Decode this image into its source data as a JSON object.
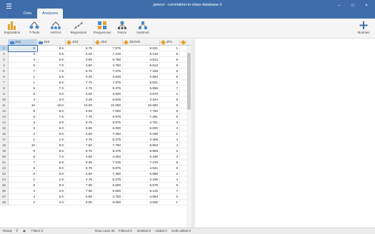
{
  "window": {
    "title": "jamovi - correlation-in-class-database-3"
  },
  "tabs": {
    "data": "Data",
    "analyses": "Analyses"
  },
  "ribbon": [
    {
      "name": "exploration",
      "label": "Exploration"
    },
    {
      "name": "ttests",
      "label": "T-Tests"
    },
    {
      "name": "anova",
      "label": "ANOVA"
    },
    {
      "name": "regression",
      "label": "Regression"
    },
    {
      "name": "frequencies",
      "label": "Frequencies"
    },
    {
      "name": "factor",
      "label": "Factor"
    },
    {
      "name": "medmod",
      "label": "medmod"
    }
  ],
  "modules": {
    "label": "Modules"
  },
  "colors": {
    "titlebar": "#3e6da9",
    "accent": "#e8a22c",
    "nominal": "#4a88cc"
  },
  "columns": [
    {
      "name": "JS1",
      "icon": "ruler-icon"
    },
    {
      "name": "JS2",
      "icon": "ruler-icon"
    },
    {
      "name": "JS3",
      "icon": "pencil-icon"
    },
    {
      "name": "JS4",
      "icon": "pencil-icon"
    },
    {
      "name": "JSAVG",
      "icon": "pencil-icon"
    },
    {
      "name": "JF1",
      "icon": "pencil-icon"
    }
  ],
  "rows": [
    [
      "9",
      "9.5",
      "6.75",
      "7.875",
      "9.031",
      "1"
    ],
    [
      "5",
      "6.5",
      "6.25",
      "7.125",
      "6.219",
      "6"
    ],
    [
      "4",
      "5.0",
      "3.50",
      "6.750",
      "4.813",
      "5"
    ],
    [
      "6",
      "7.0",
      "3.50",
      "4.750",
      "5.813",
      "6"
    ],
    [
      "7",
      "7.5",
      "6.75",
      "7.375",
      "7.156",
      "6"
    ],
    [
      "1",
      "2.5",
      "3.25",
      "3.625",
      "2.594",
      "9"
    ],
    [
      "1",
      "5.5",
      "7.75",
      "7.875",
      "5.531",
      "6"
    ],
    [
      "5",
      "7.5",
      "4.75",
      "5.375",
      "5.656",
      "7"
    ],
    [
      "6",
      "4.0",
      "3.00",
      "2.500",
      "3.875",
      "2"
    ],
    [
      "4",
      "3.0",
      "3.25",
      "6.625",
      "3.344",
      "9"
    ],
    [
      "10",
      "10.0",
      "10.00",
      "10.000",
      "10.000",
      "6"
    ],
    [
      "6",
      "8.0",
      "6.00",
      "7.000",
      "7.750",
      "5"
    ],
    [
      "5",
      "7.5",
      "7.75",
      "8.875",
      "7.281",
      "6"
    ],
    [
      "3",
      "3.5",
      "5.75",
      "6.875",
      "4.781",
      "3"
    ],
    [
      "6",
      "6.0",
      "6.00",
      "6.000",
      "6.000",
      "4"
    ],
    [
      "4",
      "5.0",
      "4.50",
      "7.250",
      "5.188",
      "1"
    ],
    [
      "1",
      "1.5",
      "4.75",
      "6.375",
      "3.406",
      "4"
    ],
    [
      "10",
      "9.0",
      "7.50",
      "7.750",
      "8.563",
      "4"
    ],
    [
      "9",
      "9.5",
      "8.75",
      "8.375",
      "8.906",
      "2"
    ],
    [
      "6",
      "7.0",
      "4.50",
      "4.250",
      "5.438",
      "3"
    ],
    [
      "7",
      "6.5",
      "8.25",
      "7.125",
      "7.219",
      "9"
    ],
    [
      "5",
      "5.0",
      "5.75",
      "5.875",
      "4.531",
      "9"
    ],
    [
      "6",
      "5.0",
      "4.50",
      "7.250",
      "5.688",
      "2"
    ],
    [
      "1",
      "1.5",
      "4.75",
      "5.375",
      "3.156",
      "4"
    ],
    [
      "6",
      "8.0",
      "7.00",
      "6.500",
      "6.875",
      "9"
    ],
    [
      "4",
      "4.0",
      "7.00",
      "5.500",
      "5.125",
      "7"
    ],
    [
      "4",
      "5.0",
      "5.50",
      "3.750",
      "4.563",
      "2"
    ],
    [
      "2",
      "4.0",
      "6.00",
      "6.000",
      "4.500",
      "1"
    ]
  ],
  "status": {
    "ready": "Ready",
    "filters": "Filters 0",
    "row_count": "Row count 30",
    "filtered": "Filtered 0",
    "deleted": "Deleted 0",
    "added": "Added 0",
    "cells_edited": "Cells edited 0"
  }
}
